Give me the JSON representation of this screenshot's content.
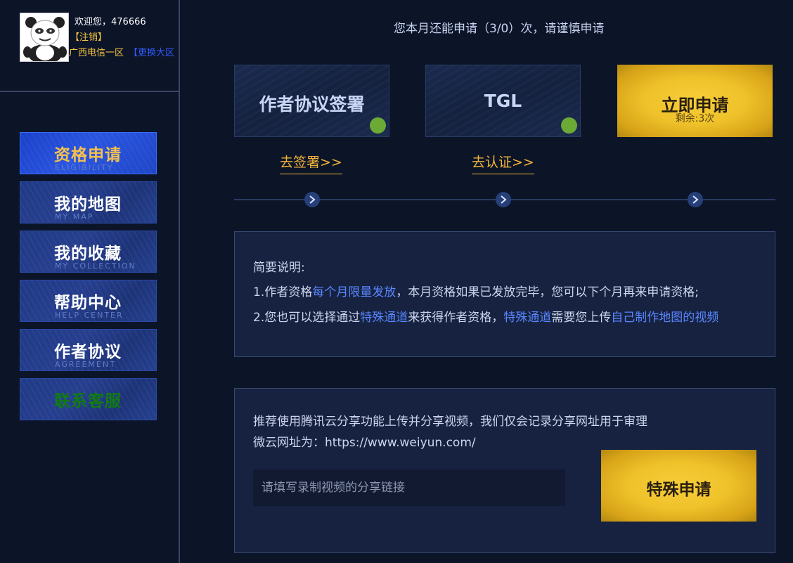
{
  "user": {
    "welcome": "欢迎您，476666",
    "logout": "【注销】",
    "region": "广西电信一区",
    "switch_region": "【更换大区"
  },
  "menu": [
    {
      "title": "资格申请",
      "sub": "ELIGIBILITY",
      "active": true
    },
    {
      "title": "我的地图",
      "sub": "MY MAP"
    },
    {
      "title": "我的收藏",
      "sub": "MY COLLECTION"
    },
    {
      "title": "帮助中心",
      "sub": "HELP CENTER"
    },
    {
      "title": "作者协议",
      "sub": "AGREEMENT"
    },
    {
      "title": "联系客服",
      "sub": ""
    }
  ],
  "notice": "您本月还能申请（3/0）次，请谨慎申请",
  "steps": [
    {
      "label": "作者协议签署",
      "link": "去签署>>",
      "done": true
    },
    {
      "label": "TGL",
      "link": "去认证>>",
      "done": true
    },
    {
      "label": "立即申请",
      "remain": "剩余:3次"
    }
  ],
  "info": {
    "heading": "简要说明:",
    "line1": {
      "a": "1.作者资格",
      "b": "每个月限量发放",
      "c": "，本月资格如果已发放完毕，您可以下个月再来申请资格;"
    },
    "line2": {
      "a": "2.您也可以选择通过",
      "b": "特殊通道",
      "c": "来获得作者资格，",
      "d": "特殊通道",
      "e": "需要您上传",
      "f": "自己制作地图的视频"
    }
  },
  "share": {
    "line1": "推荐使用腾讯云分享功能上传并分享视频，我们仅会记录分享网址用于审理",
    "line2": "微云网址为：https://www.weiyun.com/",
    "placeholder": "请填写录制视频的分享链接",
    "button": "特殊申请"
  },
  "colors": {
    "background": "#0c1428",
    "accent_gold": "#f2b53a",
    "highlight_blue": "#5a86ff",
    "done_green": "#6aaa35"
  }
}
